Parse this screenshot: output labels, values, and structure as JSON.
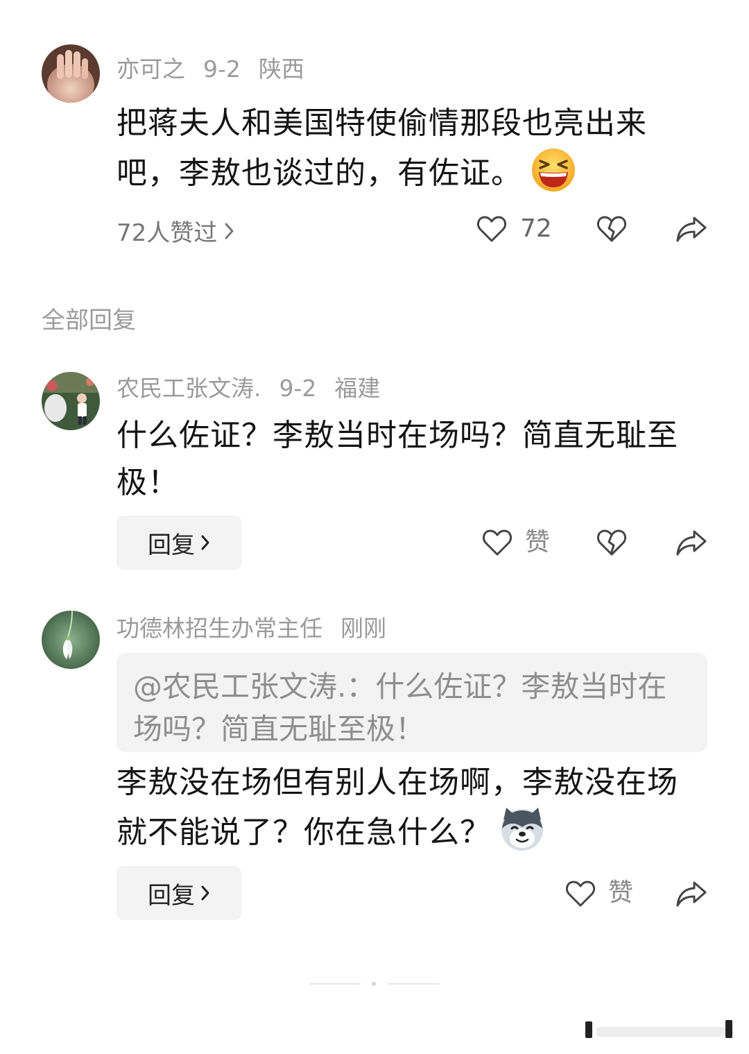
{
  "main_comment": {
    "username": "亦可之",
    "date": "9-2",
    "location": "陕西",
    "text": "把蒋夫人和美国特使偷情那段也亮出来吧，李敖也谈过的，有佐证。",
    "emoji": "grinning-squint-emoji",
    "likes_summary": "72人赞过",
    "like_count": "72"
  },
  "section_title": "全部回复",
  "replies": [
    {
      "username": "农民工张文涛.",
      "date": "9-2",
      "location": "福建",
      "text": "什么佐证？李敖当时在场吗？简直无耻至极！",
      "reply_label": "回复",
      "like_label": "赞"
    },
    {
      "username": "功德林招生办常主任",
      "date": "刚刚",
      "quote": "@农民工张文涛.：什么佐证？李敖当时在场吗？简直无耻至极！",
      "text": "李敖没在场但有别人在场啊，李敖没在场就不能说了？你在急什么？",
      "emoji": "husky-dog-emoji",
      "reply_label": "回复",
      "like_label": "赞"
    }
  ],
  "icons": {
    "like": "heart-icon",
    "dislike": "broken-heart-icon",
    "share": "share-arrow-icon",
    "chevron": "chevron-right-icon"
  },
  "colors": {
    "meta_text": "#9a9a9a",
    "body_text": "#141414",
    "button_bg": "#f3f3f3"
  }
}
